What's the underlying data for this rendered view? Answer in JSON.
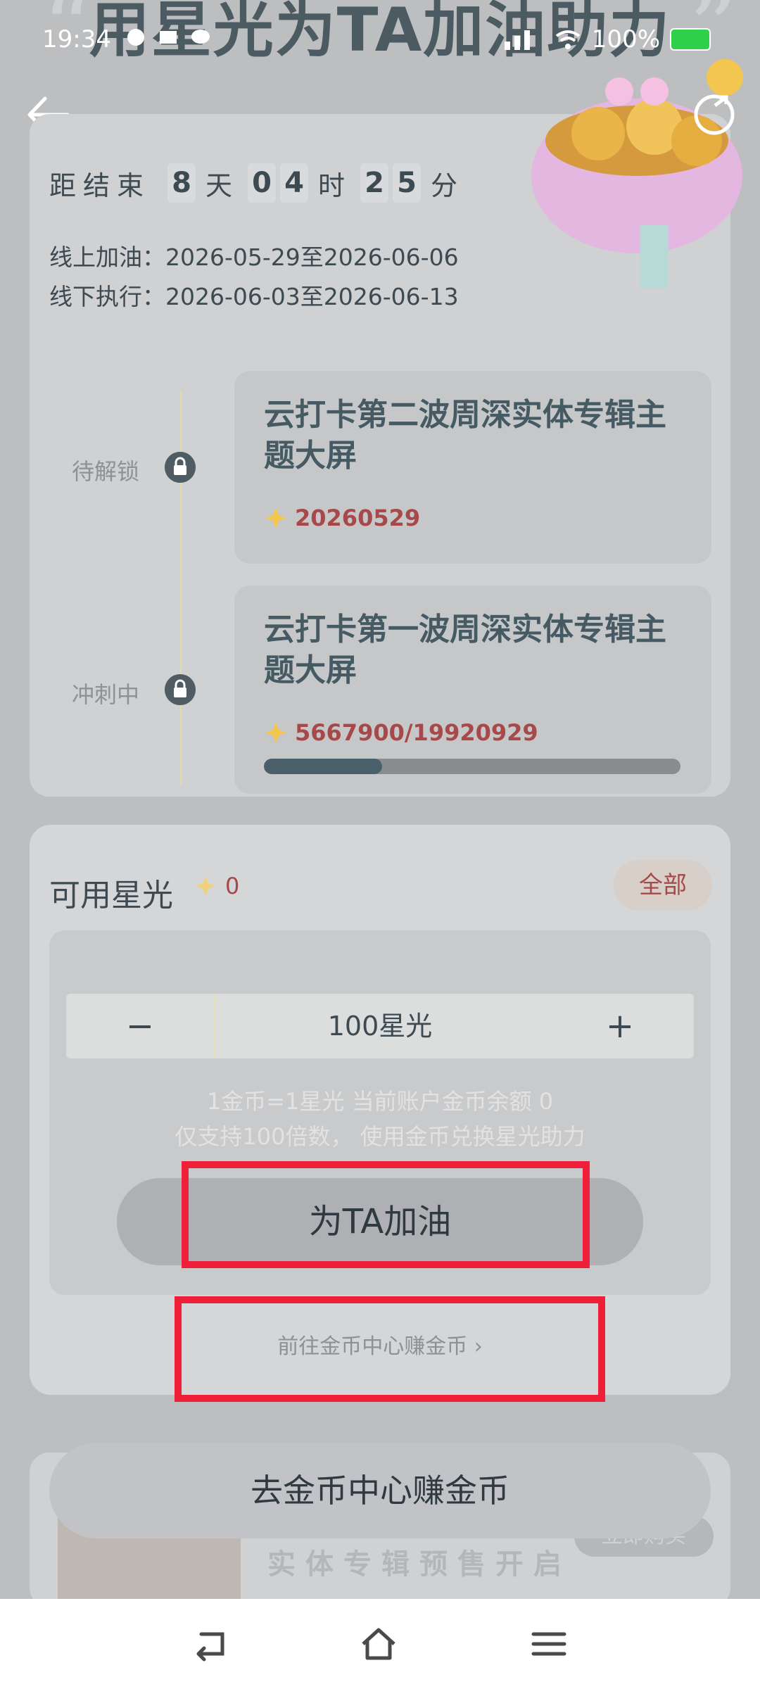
{
  "banner": {
    "title": "用星光为TA加油助力"
  },
  "status_bar": {
    "time": "19:34",
    "battery": "100%"
  },
  "countdown": {
    "label": "距结束",
    "days": [
      "8"
    ],
    "day_unit": "天",
    "hours": [
      "0",
      "4"
    ],
    "hour_unit": "时",
    "minutes": [
      "2",
      "5"
    ],
    "minute_unit": "分"
  },
  "dates": {
    "online": "线上加油：2026-05-29至2026-06-06",
    "offline": "线下执行：2026-06-03至2026-06-13"
  },
  "milestones": [
    {
      "status": "待解锁",
      "title": "云打卡第二波周深实体专辑主题大屏",
      "value": "20260529"
    },
    {
      "status": "冲刺中",
      "title": "云打卡第一波周深实体专辑主题大屏",
      "value": "5667900/19920929",
      "progress": 0.2845
    }
  ],
  "starlight": {
    "title": "可用星光",
    "count": "0",
    "all_label": "全部",
    "minus": "−",
    "plus": "+",
    "amount": "100星光",
    "hint1": "1金币=1星光 当前账户金币余额 0",
    "hint2": "仅支持100倍数， 使用金币兑换星光助力",
    "cheer_label": "为TA加油",
    "earn_link": "前往金币中心赚金币 ›"
  },
  "promo": {
    "text": "实体专辑预售开启",
    "badge": "立即购买",
    "float_button": "去金币中心赚金币"
  },
  "colors": {
    "accent_red": "#ef1f3a",
    "value_red": "#a7494a",
    "progress": "#49606a"
  }
}
